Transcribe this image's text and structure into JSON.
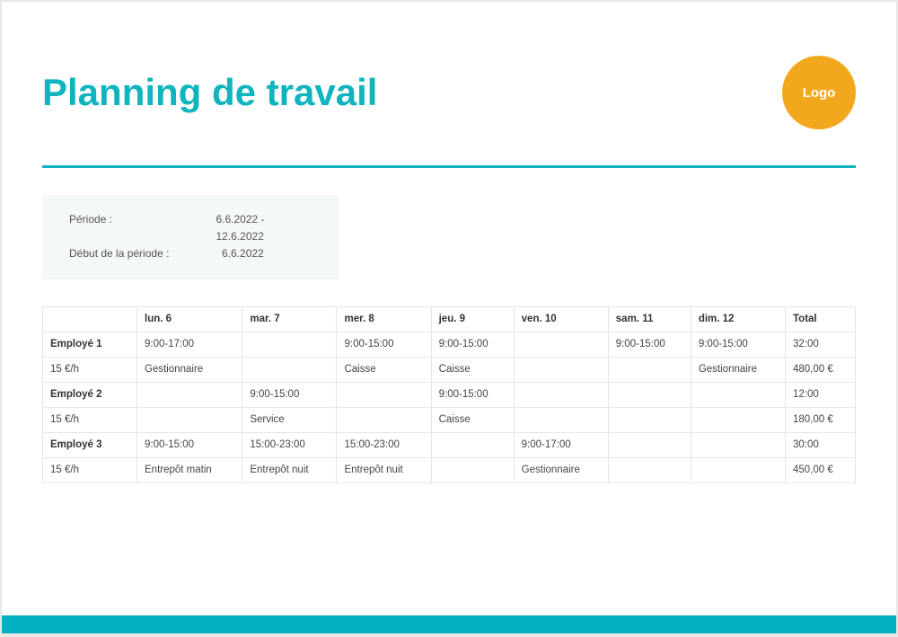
{
  "header": {
    "title": "Planning de travail",
    "logo_label": "Logo"
  },
  "info": {
    "period_label": "Période :",
    "period_value": "6.6.2022  -  12.6.2022",
    "start_label": "Début de la période :",
    "start_value": "6.6.2022"
  },
  "table": {
    "headers": [
      "",
      "lun. 6",
      "mar. 7",
      "mer. 8",
      "jeu. 9",
      "ven. 10",
      "sam. 11",
      "dim. 12",
      "Total"
    ],
    "rows": [
      {
        "emp": "Employé 1",
        "rate": "15 €/h",
        "times": [
          "9:00-17:00",
          "",
          "9:00-15:00",
          "9:00-15:00",
          "",
          "9:00-15:00",
          "9:00-15:00",
          "32:00"
        ],
        "tasks": [
          "Gestionnaire",
          "",
          "Caisse",
          "Caisse",
          "",
          "",
          "Gestionnaire",
          "480,00 €"
        ]
      },
      {
        "emp": "Employé 2",
        "rate": "15 €/h",
        "times": [
          "",
          "9:00-15:00",
          "",
          "9:00-15:00",
          "",
          "",
          "",
          "12:00"
        ],
        "tasks": [
          "",
          "Service",
          "",
          "Caisse",
          "",
          "",
          "",
          "180,00 €"
        ]
      },
      {
        "emp": "Employé 3",
        "rate": "15 €/h",
        "times": [
          "9:00-15:00",
          "15:00-23:00",
          "15:00-23:00",
          "",
          "9:00-17:00",
          "",
          "",
          "30:00"
        ],
        "tasks": [
          "Entrepôt matin",
          "Entrepôt nuit",
          "Entrepôt nuit",
          "",
          "Gestionnaire",
          "",
          "",
          "450,00 €"
        ]
      }
    ]
  }
}
